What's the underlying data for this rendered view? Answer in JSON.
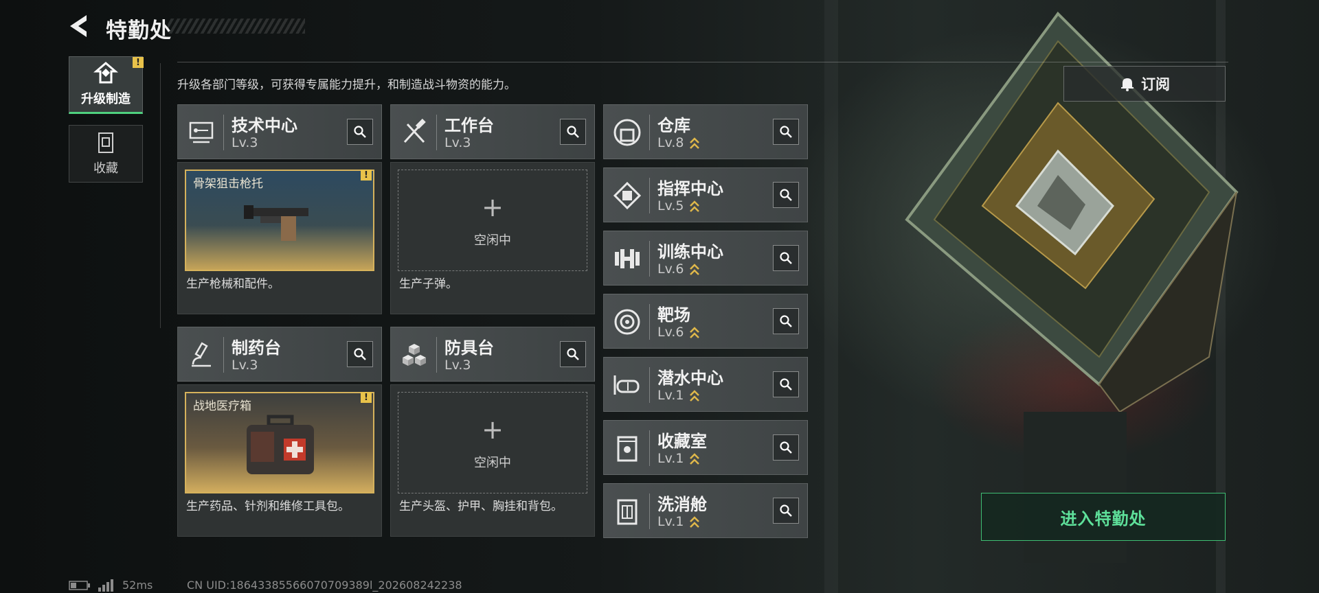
{
  "header": {
    "title": "特勤处"
  },
  "sidebar": {
    "items": [
      {
        "label": "升级制造",
        "active": true,
        "alert": "!"
      },
      {
        "label": "收藏",
        "active": false
      }
    ]
  },
  "description": "升级各部门等级，可获得专属能力提升，和制造战斗物资的能力。",
  "stations": [
    {
      "name": "技术中心",
      "level": "Lv.3",
      "icon": "circuit-board-icon",
      "item": "骨架狙击枪托",
      "item_alert": "!",
      "desc": "生产枪械和配件。"
    },
    {
      "name": "工作台",
      "level": "Lv.3",
      "icon": "tools-icon",
      "idle": "空闲中",
      "desc": "生产子弹。"
    },
    {
      "name": "制药台",
      "level": "Lv.3",
      "icon": "microscope-icon",
      "item": "战地医疗箱",
      "item_alert": "!",
      "desc": "生产药品、针剂和维修工具包。"
    },
    {
      "name": "防具台",
      "level": "Lv.3",
      "icon": "cubes-icon",
      "idle": "空闲中",
      "desc": "生产头盔、护甲、胸挂和背包。"
    }
  ],
  "facilities": [
    {
      "name": "仓库",
      "level": "Lv.8",
      "icon": "warehouse-icon"
    },
    {
      "name": "指挥中心",
      "level": "Lv.5",
      "icon": "chip-icon"
    },
    {
      "name": "训练中心",
      "level": "Lv.6",
      "icon": "dumbbell-icon"
    },
    {
      "name": "靶场",
      "level": "Lv.6",
      "icon": "target-icon"
    },
    {
      "name": "潜水中心",
      "level": "Lv.1",
      "icon": "diving-mask-icon"
    },
    {
      "name": "收藏室",
      "level": "Lv.1",
      "icon": "display-case-icon"
    },
    {
      "name": "洗消舱",
      "level": "Lv.1",
      "icon": "decon-pod-icon"
    }
  ],
  "subscribe_label": "订阅",
  "enter_label": "进入特勤处",
  "status": {
    "ping": "52ms",
    "uid": "CN UID:18643385566070709389l_202608242238"
  },
  "colors": {
    "accent_green": "#4fd17f",
    "gold": "#d6b25c",
    "warning": "#e8c24a"
  }
}
